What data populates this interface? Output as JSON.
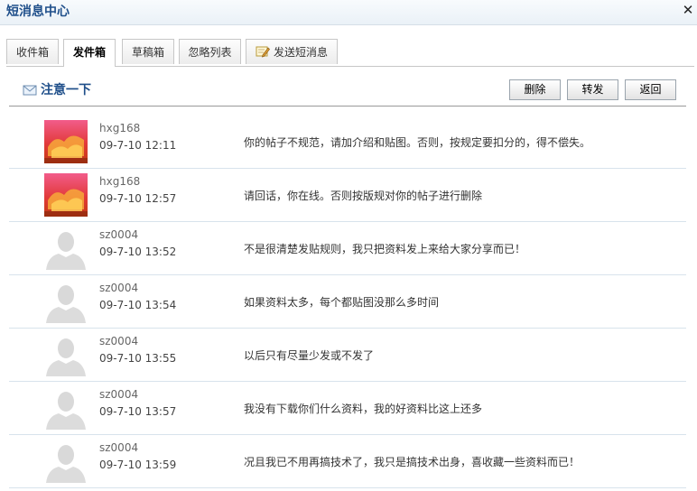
{
  "window": {
    "title": "短消息中心"
  },
  "tabs": [
    {
      "label": "收件箱",
      "active": false
    },
    {
      "label": "发件箱",
      "active": true
    },
    {
      "label": "草稿箱",
      "active": false
    },
    {
      "label": "忽略列表",
      "active": false
    },
    {
      "label": "发送短消息",
      "active": false,
      "icon": "pen-icon"
    }
  ],
  "toolbar": {
    "title": "注意一下",
    "delete_label": "删除",
    "forward_label": "转发",
    "back_label": "返回"
  },
  "colors": {
    "accent": "#1f4f8a",
    "row_divider": "#d8e3ec"
  },
  "messages": [
    {
      "sender": "hxg168",
      "time": "09-7-10 12:11",
      "text": "你的帖子不规范，请加介绍和贴图。否则，按规定要扣分的，得不偿失。",
      "avatar": "photo-avatar"
    },
    {
      "sender": "hxg168",
      "time": "09-7-10 12:57",
      "text": "请回话，你在线。否则按版规对你的帖子进行删除",
      "avatar": "photo-avatar"
    },
    {
      "sender": "sz0004",
      "time": "09-7-10 13:52",
      "text": "不是很清楚发贴规则，我只把资料发上来给大家分享而已！",
      "avatar": "default-avatar"
    },
    {
      "sender": "sz0004",
      "time": "09-7-10 13:54",
      "text": "如果资料太多，每个都贴图没那么多时间",
      "avatar": "default-avatar"
    },
    {
      "sender": "sz0004",
      "time": "09-7-10 13:55",
      "text": "以后只有尽量少发或不发了",
      "avatar": "default-avatar"
    },
    {
      "sender": "sz0004",
      "time": "09-7-10 13:57",
      "text": "我没有下载你们什么资料，我的好资料比这上还多",
      "avatar": "default-avatar"
    },
    {
      "sender": "sz0004",
      "time": "09-7-10 13:59",
      "text": "况且我已不用再搞技术了，我只是搞技术出身，喜收藏一些资料而已！",
      "avatar": "default-avatar"
    }
  ]
}
